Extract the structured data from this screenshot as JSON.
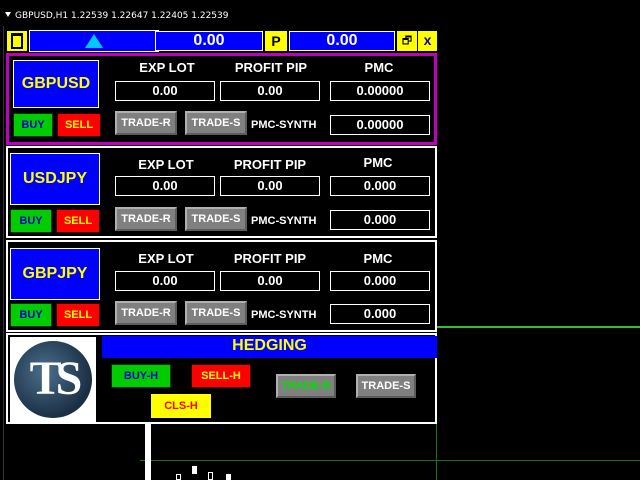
{
  "title_bar": {
    "symbol_info": "GBPUSD,H1  1.22539 1.22647 1.22405 1.22539"
  },
  "toolbar": {
    "value_left": "0.00",
    "p_label": "P",
    "value_right": "0.00",
    "restore_label": "🗗",
    "close_label": "x"
  },
  "panels": [
    {
      "symbol": "GBPUSD",
      "buy_label": "BUY",
      "sell_label": "SELL",
      "exp_lot_label": "EXP LOT",
      "profit_pip_label": "PROFIT PIP",
      "pmc_label": "PMC",
      "exp_lot": "0.00",
      "profit_pip": "0.00",
      "pmc": "0.00000",
      "trade_r_label": "TRADE-R",
      "trade_s_label": "TRADE-S",
      "pmc_synth_label": "PMC-SYNTH",
      "pmc_synth": "0.00000"
    },
    {
      "symbol": "USDJPY",
      "buy_label": "BUY",
      "sell_label": "SELL",
      "exp_lot_label": "EXP LOT",
      "profit_pip_label": "PROFIT PIP",
      "pmc_label": "PMC",
      "exp_lot": "0.00",
      "profit_pip": "0.00",
      "pmc": "0.000",
      "trade_r_label": "TRADE-R",
      "trade_s_label": "TRADE-S",
      "pmc_synth_label": "PMC-SYNTH",
      "pmc_synth": "0.000"
    },
    {
      "symbol": "GBPJPY",
      "buy_label": "BUY",
      "sell_label": "SELL",
      "exp_lot_label": "EXP LOT",
      "profit_pip_label": "PROFIT PIP",
      "pmc_label": "PMC",
      "exp_lot": "0.00",
      "profit_pip": "0.00",
      "pmc": "0.000",
      "trade_r_label": "TRADE-R",
      "trade_s_label": "TRADE-S",
      "pmc_synth_label": "PMC-SYNTH",
      "pmc_synth": "0.000"
    }
  ],
  "hedging": {
    "title": "HEDGING",
    "buy_h_label": "BUY-H",
    "sell_h_label": "SELL-H",
    "cls_h_label": "CLS-H",
    "trade_r_label": "TRADE-R",
    "trade_s_label": "TRADE-S"
  },
  "logo": {
    "text": "TS"
  },
  "colors": {
    "panel_selected_border": "#c000c0",
    "symbol_bg": "#0000ff",
    "symbol_text": "#ffff00",
    "buy_bg": "#00cc00",
    "sell_bg": "#ff0000",
    "grid": "#1f6f1f"
  }
}
